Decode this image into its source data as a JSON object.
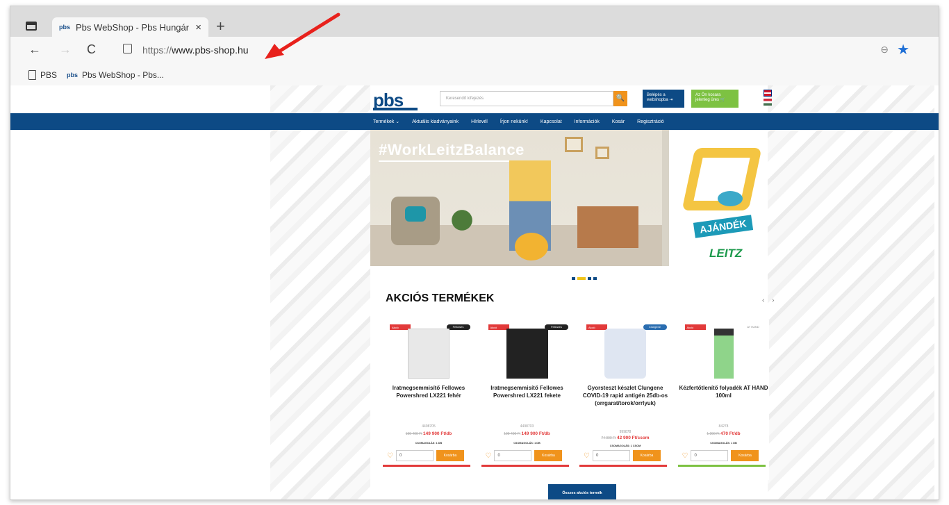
{
  "browser": {
    "tab_title": "Pbs WebShop - Pbs Hungária W",
    "tab_close": "×",
    "new_tab": "+",
    "url_prefix": "https://",
    "url_domain": "www.pbs-shop.hu",
    "favicon_text": "pbs",
    "nav": {
      "back": "←",
      "forward": "→",
      "reload": "C"
    },
    "zoom_icon": "⊖",
    "star_icon": "★",
    "bookmarks": [
      {
        "label": "PBS",
        "icon": "document-icon"
      },
      {
        "label": "Pbs WebShop - Pbs...",
        "icon": "pbs-favicon"
      }
    ]
  },
  "site": {
    "logo": "pbs",
    "search_placeholder": "Keresendő kifejezés",
    "search_icon": "🔍",
    "login_label": "Belépés a webshopba",
    "login_icon": "⇥",
    "cart_label": "Az Ön kosara jelenleg üres",
    "cart_icon": "🛒",
    "nav_items": [
      "Termékek ⌄",
      "Aktuális kiadványaink",
      "Hírlevél",
      "Írjon nekünk!",
      "Kapcsolat",
      "Információk",
      "Kosár",
      "Regisztráció"
    ],
    "banner": {
      "title": "#WorkLeitzBalance",
      "side_badge": "AJÁNDÉK",
      "side_brand": "LEITZ"
    },
    "section_title": "AKCIÓS TERMÉKEK",
    "carousel_arrows": "‹ ›",
    "all_button": "Összes akciós termék",
    "products": [
      {
        "badge": "Akció",
        "brand": "Fellowes",
        "title": "Iratmegsemmisítő Fellowes Powershred LX221 fehér",
        "sku": "4498705",
        "old_price": "199 400 Ft",
        "new_price": "149 900 Ft",
        "unit": "/db",
        "pack": "CSOMAGOLÁS: 1 DB",
        "qty": "0",
        "buy": "Kosárba",
        "img_color": "#e8e8e8",
        "underline": "red"
      },
      {
        "badge": "Akció",
        "brand": "Fellowes",
        "title": "Iratmegsemmisítő Fellowes Powershred LX221 fekete",
        "sku": "4498703",
        "old_price": "199 400 Ft",
        "new_price": "149 900 Ft",
        "unit": "/db",
        "pack": "CSOMAGOLÁS: 1 DB",
        "qty": "0",
        "buy": "Kosárba",
        "img_color": "#222222",
        "underline": "red"
      },
      {
        "badge": "Akció",
        "brand": "Clungene",
        "title": "Gyorsteszt készlet Clungene COVID-19 rapid antigén 25db-os (orrgarat/torok/orrlyuk)",
        "sku": "999878",
        "old_price": "74 990 Ft",
        "new_price": "42 900 Ft",
        "unit": "/csom",
        "pack": "CSOMAGOLÁS: 1 CSOM",
        "qty": "0",
        "buy": "Kosárba",
        "img_color": "#dfe6f2",
        "underline": "red"
      },
      {
        "badge": "Akció",
        "brand": "AT HAND",
        "title": "Kézfertőtlenítő folyadék AT HAND 100ml",
        "sku": "84278",
        "old_price": "1 290 Ft",
        "new_price": "470 Ft",
        "unit": "/db",
        "pack": "CSOMAGOLÁS: 1 DB",
        "qty": "0",
        "buy": "Kosárba",
        "img_color": "#8fd48a",
        "underline": "green"
      }
    ]
  },
  "colors": {
    "brand_blue": "#0d4a85",
    "accent_orange": "#f0931c",
    "sale_red": "#e23a3a",
    "cart_green": "#7dc242",
    "annotation_arrow": "#e8211c"
  }
}
